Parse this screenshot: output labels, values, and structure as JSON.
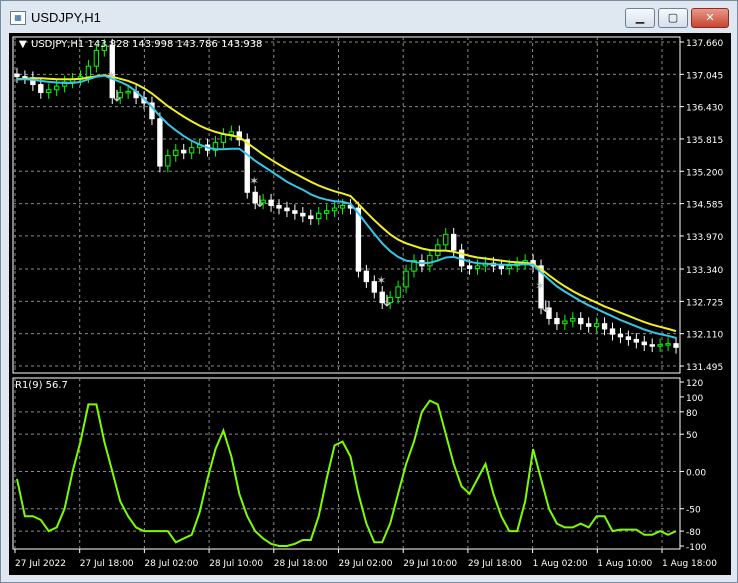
{
  "window": {
    "title": "USDJPY,H1",
    "icon": "chart-window-icon"
  },
  "chart_header": "USDJPY,H1  143.828 143.998 143.786 143.938",
  "indicator_label": "R1(9) 56.7",
  "colors": {
    "background": "#000000",
    "grid": "#8a8a8a",
    "bull_candle": "#00ff00",
    "bear_candle": "#ffffff",
    "ma_fast": "#33c8e8",
    "ma_slow": "#f0f020",
    "oscillator": "#7cfc00",
    "arrow": "#c8c8c8"
  },
  "price_axis": [
    "137.660",
    "137.045",
    "136.430",
    "135.815",
    "135.200",
    "134.585",
    "133.970",
    "133.340",
    "132.725",
    "132.110",
    "131.495"
  ],
  "osc_axis": [
    "120",
    "100",
    "80",
    "50",
    "0.00",
    "-50",
    "-80",
    "-100"
  ],
  "time_axis": [
    "27 Jul 2022",
    "27 Jul 18:00",
    "28 Jul 02:00",
    "28 Jul 10:00",
    "28 Jul 18:00",
    "29 Jul 02:00",
    "29 Jul 10:00",
    "29 Jul 18:00",
    "1 Aug 02:00",
    "1 Aug 10:00",
    "1 Aug 18:00"
  ],
  "chart_data": {
    "type": "line",
    "price_range": [
      131.495,
      137.66
    ],
    "osc_range": [
      -100,
      120
    ],
    "candles_close": [
      137.0,
      136.98,
      136.85,
      136.7,
      136.75,
      136.82,
      136.9,
      136.95,
      137.0,
      137.2,
      137.5,
      137.6,
      136.6,
      136.7,
      136.72,
      136.6,
      136.5,
      136.2,
      135.3,
      135.5,
      135.6,
      135.55,
      135.65,
      135.7,
      135.6,
      135.75,
      135.9,
      135.95,
      135.8,
      134.8,
      134.6,
      134.65,
      134.55,
      134.5,
      134.45,
      134.4,
      134.35,
      134.3,
      134.4,
      134.45,
      134.5,
      134.55,
      134.5,
      133.3,
      133.1,
      132.9,
      132.7,
      132.8,
      133.0,
      133.3,
      133.5,
      133.4,
      133.6,
      133.8,
      134.0,
      133.7,
      133.4,
      133.35,
      133.4,
      133.45,
      133.4,
      133.35,
      133.4,
      133.45,
      133.5,
      133.4,
      132.6,
      132.4,
      132.3,
      132.35,
      132.4,
      132.3,
      132.25,
      132.3,
      132.2,
      132.1,
      132.05,
      132.0,
      131.95,
      131.9,
      131.88,
      131.9,
      131.92,
      131.85
    ],
    "ma_fast": [
      136.95,
      136.95,
      136.94,
      136.92,
      136.9,
      136.89,
      136.88,
      136.88,
      136.9,
      136.95,
      137.0,
      137.02,
      136.96,
      136.9,
      136.83,
      136.72,
      136.58,
      136.42,
      136.25,
      136.1,
      135.98,
      135.87,
      135.78,
      135.71,
      135.65,
      135.62,
      135.62,
      135.63,
      135.63,
      135.52,
      135.4,
      135.3,
      135.2,
      135.1,
      135.0,
      134.92,
      134.85,
      134.76,
      134.7,
      134.66,
      134.63,
      134.62,
      134.58,
      134.4,
      134.2,
      134.01,
      133.83,
      133.68,
      133.57,
      133.5,
      133.48,
      133.45,
      133.46,
      133.5,
      133.56,
      133.57,
      133.53,
      133.48,
      133.45,
      133.44,
      133.43,
      133.42,
      133.42,
      133.42,
      133.43,
      133.42,
      133.28,
      133.14,
      133.01,
      132.91,
      132.82,
      132.73,
      132.65,
      132.58,
      132.51,
      132.44,
      132.37,
      132.31,
      132.25,
      132.19,
      132.14,
      132.1,
      132.07,
      132.03
    ],
    "ma_slow": [
      136.95,
      136.96,
      136.97,
      136.97,
      136.96,
      136.95,
      136.95,
      136.95,
      136.96,
      136.98,
      137.01,
      137.03,
      137.0,
      136.96,
      136.92,
      136.86,
      136.78,
      136.68,
      136.56,
      136.44,
      136.34,
      136.24,
      136.15,
      136.07,
      136.0,
      135.95,
      135.91,
      135.88,
      135.85,
      135.74,
      135.63,
      135.52,
      135.42,
      135.33,
      135.24,
      135.16,
      135.08,
      135.0,
      134.93,
      134.87,
      134.82,
      134.78,
      134.73,
      134.58,
      134.42,
      134.27,
      134.13,
      134.0,
      133.9,
      133.83,
      133.78,
      133.73,
      133.7,
      133.69,
      133.69,
      133.67,
      133.63,
      133.59,
      133.56,
      133.54,
      133.52,
      133.5,
      133.48,
      133.47,
      133.46,
      133.44,
      133.34,
      133.22,
      133.11,
      133.01,
      132.92,
      132.84,
      132.77,
      132.7,
      132.63,
      132.57,
      132.51,
      132.45,
      132.39,
      132.33,
      132.28,
      132.24,
      132.2,
      132.16
    ],
    "osc": [
      -10,
      -60,
      -60,
      -65,
      -80,
      -75,
      -50,
      0,
      40,
      90,
      90,
      40,
      0,
      -40,
      -60,
      -75,
      -80,
      -80,
      -80,
      -80,
      -95,
      -90,
      -85,
      -55,
      -10,
      30,
      55,
      20,
      -30,
      -60,
      -80,
      -90,
      -97,
      -100,
      -100,
      -97,
      -92,
      -92,
      -60,
      -10,
      35,
      40,
      20,
      -30,
      -70,
      -95,
      -95,
      -70,
      -30,
      10,
      40,
      80,
      95,
      90,
      50,
      10,
      -20,
      -30,
      -10,
      10,
      -30,
      -60,
      -80,
      -80,
      -40,
      30,
      -10,
      -50,
      -70,
      -75,
      -75,
      -70,
      -75,
      -60,
      -60,
      -80,
      -78,
      -78,
      -78,
      -85,
      -85,
      -80,
      -85,
      -80
    ]
  }
}
